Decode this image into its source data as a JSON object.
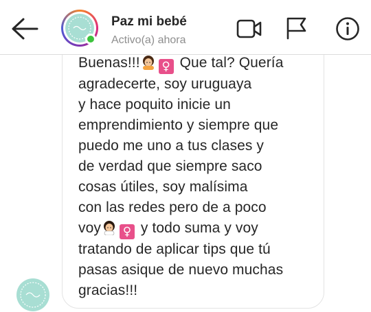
{
  "header": {
    "contact_name": "Paz mi bebé",
    "status": "Activo(a) ahora",
    "icons": {
      "back": "back-arrow-icon",
      "video": "video-camera-icon",
      "flag": "flag-icon",
      "info": "info-icon"
    }
  },
  "colors": {
    "online": "#3ec33e",
    "avatar_bg": "#a8ded3",
    "text": "#262626",
    "muted": "#8e8e8e",
    "female_sign_bg": "#e8508a"
  },
  "message": {
    "lines": [
      {
        "before": "Buenas!!!",
        "emoji": true,
        "after": " Que tal? Quería"
      },
      {
        "text": "agradecerte, soy uruguaya"
      },
      {
        "text": "y hace poquito inicie un"
      },
      {
        "text": "emprendimiento y siempre que"
      },
      {
        "text": "puedo me uno a tus clases y"
      },
      {
        "text": "de verdad que siempre saco"
      },
      {
        "text": "cosas útiles, soy malísima"
      },
      {
        "text": "con las redes pero de a poco"
      },
      {
        "before": "voy",
        "emoji": true,
        "after": " y todo suma y voy"
      },
      {
        "text": "tratando de aplicar tips que tú"
      },
      {
        "text": "pasas asique de nuevo muchas"
      },
      {
        "text": "gracias!!!"
      }
    ],
    "emoji_name": "woman-gesturing-emoji",
    "female_sign": "♀"
  }
}
